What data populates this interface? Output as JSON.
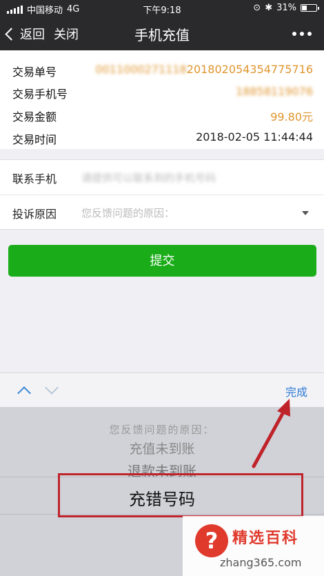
{
  "status_bar": {
    "carrier": "中国移动",
    "network": "4G",
    "time": "下午9:18",
    "battery": "31%"
  },
  "nav": {
    "back_label": "返回",
    "close_label": "关闭",
    "title": "手机充值"
  },
  "transaction": {
    "rows": [
      {
        "label": "交易单号",
        "value": "0010000271120180205435477571​6",
        "display": "201802054354775716"
      },
      {
        "label": "交易手机号",
        "value": "18858119076"
      },
      {
        "label": "交易金额",
        "value": "99.80元"
      },
      {
        "label": "交易时间",
        "value": "2018-02-05 11:44:44"
      }
    ]
  },
  "form": {
    "phone_label": "联系手机",
    "phone_placeholder": "请提供可以联系到的手机号码",
    "reason_label": "投诉原因",
    "reason_placeholder": "您反馈问题的原因："
  },
  "submit_label": "提交",
  "picker_toolbar": {
    "done_label": "完成"
  },
  "picker_options": [
    "您反馈问题的原因：",
    "充值未到账",
    "退款未到账",
    "充错号码"
  ],
  "watermark": {
    "brand": "精选百科",
    "domain": "zhang365.com",
    "icon_glyph": "?"
  },
  "colors": {
    "accent_green": "#1aad19",
    "amount_orange": "#e0952e",
    "link_blue": "#2d7ad6",
    "annotation_red": "#c0222a"
  }
}
